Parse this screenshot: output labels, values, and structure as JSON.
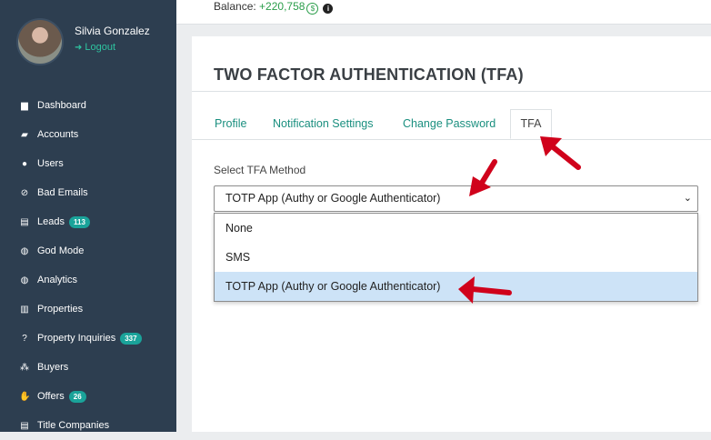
{
  "user": {
    "name": "Silvia Gonzalez",
    "logout": "Logout"
  },
  "nav": [
    {
      "label": "Dashboard",
      "icon": "chart-icon",
      "glyph": "▆"
    },
    {
      "label": "Accounts",
      "icon": "briefcase-icon",
      "glyph": "▰"
    },
    {
      "label": "Users",
      "icon": "user-icon",
      "glyph": "●"
    },
    {
      "label": "Bad Emails",
      "icon": "ban-icon",
      "glyph": "⊘"
    },
    {
      "label": "Leads",
      "icon": "id-card-icon",
      "glyph": "▤",
      "badge": "113"
    },
    {
      "label": "God Mode",
      "icon": "globe-icon",
      "glyph": "◍"
    },
    {
      "label": "Analytics",
      "icon": "globe-icon",
      "glyph": "◍"
    },
    {
      "label": "Properties",
      "icon": "building-icon",
      "glyph": "▥"
    },
    {
      "label": "Property Inquiries",
      "icon": "question-circle-icon",
      "glyph": "?",
      "badge": "337"
    },
    {
      "label": "Buyers",
      "icon": "users-icon",
      "glyph": "⁂"
    },
    {
      "label": "Offers",
      "icon": "handshake-icon",
      "glyph": "✋",
      "badge": "26"
    },
    {
      "label": "Title Companies",
      "icon": "list-icon",
      "glyph": "▤"
    }
  ],
  "topbar": {
    "balance_label": "Balance:",
    "balance_value": "+220,758"
  },
  "page": {
    "title": "TWO FACTOR AUTHENTICATION (TFA)"
  },
  "tabs": [
    {
      "label": "Profile"
    },
    {
      "label": "Notification Settings"
    },
    {
      "label": "Change Password"
    },
    {
      "label": "TFA",
      "active": true
    }
  ],
  "tfa_form": {
    "label": "Select TFA Method",
    "selected": "TOTP App (Authy or Google Authenticator)",
    "options": [
      "None",
      "SMS",
      "TOTP App (Authy or Google Authenticator)"
    ]
  },
  "colors": {
    "sidebar": "#2d3e50",
    "accent": "#1a8f7f",
    "annotation_arrow": "#d0021b"
  }
}
